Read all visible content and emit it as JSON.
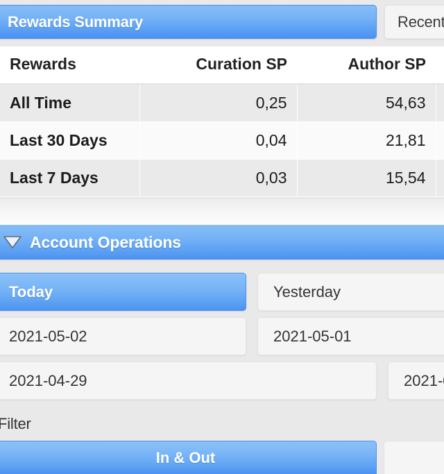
{
  "tabs": [
    {
      "label": "Rewards Summary",
      "active": true
    },
    {
      "label": "Recent",
      "active": false
    }
  ],
  "rewards_table": {
    "headers": [
      "Rewards",
      "Curation SP",
      "Author SP",
      ""
    ],
    "rows": [
      {
        "period": "All Time",
        "curation_sp": "0,25",
        "author_sp": "54,63"
      },
      {
        "period": "Last 30 Days",
        "curation_sp": "0,04",
        "author_sp": "21,81"
      },
      {
        "period": "Last 7 Days",
        "curation_sp": "0,03",
        "author_sp": "15,54"
      }
    ]
  },
  "account_operations": {
    "title": "Account Operations",
    "caret_icon": "chevron-down-icon",
    "date_buttons": [
      {
        "label": "Today",
        "selected": true
      },
      {
        "label": "Yesterday",
        "selected": false
      },
      {
        "label": "2021-05-02",
        "selected": false
      },
      {
        "label": "2021-05-01",
        "selected": false
      },
      {
        "label": "2021-04-29",
        "selected": false
      },
      {
        "label": "2021-0",
        "selected": false
      }
    ],
    "filter_label": "Filter"
  },
  "bottom": {
    "in_out_label": "In & Out"
  },
  "colors": {
    "accent_blue_top": "#86bdf7",
    "accent_blue_bottom": "#4b92f1",
    "page_background": "#e9e9e9",
    "row_odd": "#eaeaea",
    "row_even": "#fafafa",
    "button_gray": "#f5f5f5"
  }
}
